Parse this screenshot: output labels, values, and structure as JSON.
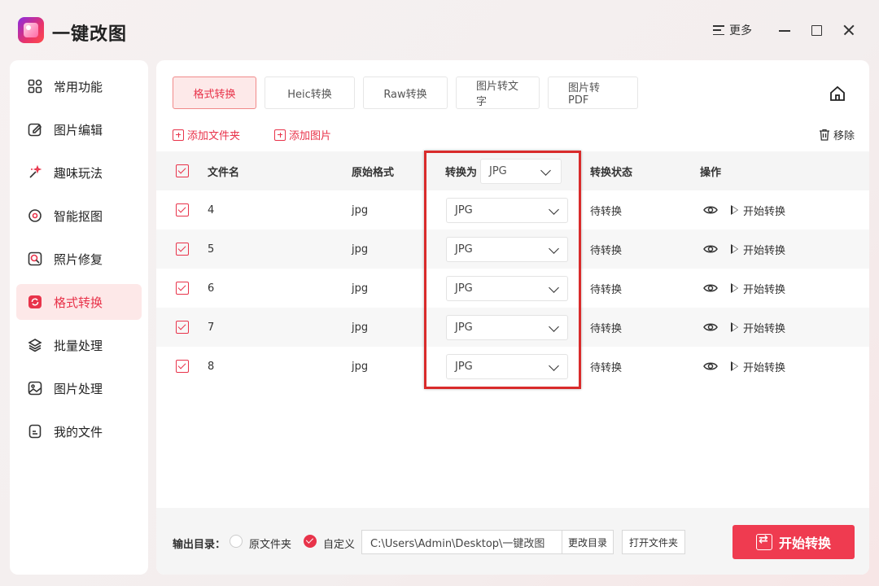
{
  "app": {
    "title": "一键改图",
    "more_label": "更多"
  },
  "sidebar": {
    "items": [
      {
        "label": "常用功能",
        "icon": "grid-icon"
      },
      {
        "label": "图片编辑",
        "icon": "edit-icon"
      },
      {
        "label": "趣味玩法",
        "icon": "magic-icon"
      },
      {
        "label": "智能抠图",
        "icon": "target-icon"
      },
      {
        "label": "照片修复",
        "icon": "repair-icon"
      },
      {
        "label": "格式转换",
        "icon": "convert-icon",
        "active": true
      },
      {
        "label": "批量处理",
        "icon": "layers-icon"
      },
      {
        "label": "图片处理",
        "icon": "image-icon"
      },
      {
        "label": "我的文件",
        "icon": "file-icon"
      }
    ]
  },
  "tabs": [
    "格式转换",
    "Heic转换",
    "Raw转换",
    "图片转文字",
    "图片转PDF"
  ],
  "actions": {
    "add_folder": "添加文件夹",
    "add_image": "添加图片",
    "remove": "移除"
  },
  "table": {
    "headers": {
      "name": "文件名",
      "orig_format": "原始格式",
      "convert_to": "转换为",
      "status": "转换状态",
      "ops": "操作"
    },
    "global_target": "JPG",
    "rows": [
      {
        "name": "4",
        "format": "jpg",
        "target": "JPG",
        "status": "待转换",
        "action": "开始转换"
      },
      {
        "name": "5",
        "format": "jpg",
        "target": "JPG",
        "status": "待转换",
        "action": "开始转换"
      },
      {
        "name": "6",
        "format": "jpg",
        "target": "JPG",
        "status": "待转换",
        "action": "开始转换"
      },
      {
        "name": "7",
        "format": "jpg",
        "target": "JPG",
        "status": "待转换",
        "action": "开始转换"
      },
      {
        "name": "8",
        "format": "jpg",
        "target": "JPG",
        "status": "待转换",
        "action": "开始转换"
      }
    ]
  },
  "footer": {
    "output_label": "输出目录：",
    "radio_original": "原文件夹",
    "radio_custom": "自定义",
    "path": "C:\\Users\\Admin\\Desktop\\一键改图",
    "change_dir": "更改目录",
    "open_folder": "打开文件夹",
    "start": "开始转换"
  },
  "colors": {
    "accent": "#e8334a",
    "start_button": "#ef3b50",
    "highlight": "#d92b2b"
  }
}
